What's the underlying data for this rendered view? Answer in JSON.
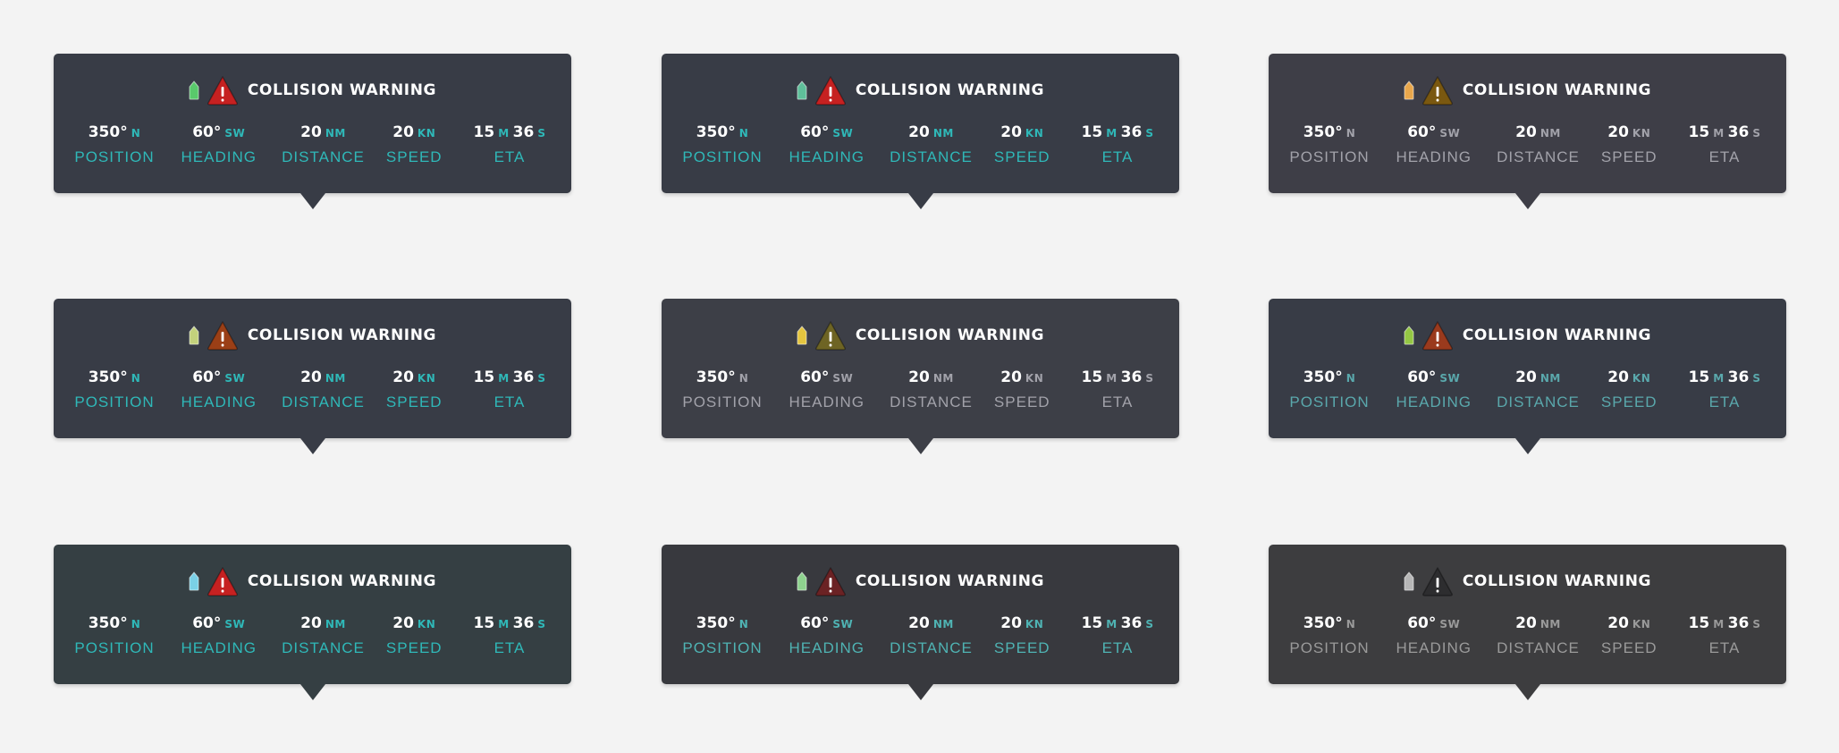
{
  "title": "COLLISION WARNING",
  "metrics": {
    "position": {
      "value": "350°",
      "unit": "N",
      "label": "POSITION"
    },
    "heading": {
      "value": "60°",
      "unit": "SW",
      "label": "HEADING"
    },
    "distance": {
      "value": "20",
      "unit": "NM",
      "label": "DISTANCE"
    },
    "speed": {
      "value": "20",
      "unit": "KN",
      "label": "SPEED"
    },
    "eta": {
      "minutes": "15",
      "minutes_unit": "M",
      "seconds": "36",
      "seconds_unit": "S",
      "label": "ETA"
    }
  },
  "cards": [
    {
      "bg": "#383c46",
      "accent": "#2fb8b8",
      "boat": "#59c96b",
      "warn": "#c62121"
    },
    {
      "bg": "#383c46",
      "accent": "#2fb8b8",
      "boat": "#5fbf9a",
      "warn": "#c62121"
    },
    {
      "bg": "#3e3e47",
      "accent": "#a2a2aa",
      "boat": "#e9a74c",
      "warn": "#7a5810"
    },
    {
      "bg": "#383c46",
      "accent": "#2fb8b8",
      "boat": "#c3d27c",
      "warn": "#9b3f16"
    },
    {
      "bg": "#3d3f47",
      "accent": "#a2a2aa",
      "boat": "#e4c53f",
      "warn": "#6e6424"
    },
    {
      "bg": "#383c46",
      "accent": "#5aa8ac",
      "boat": "#94c744",
      "warn": "#9a3a1d"
    },
    {
      "bg": "#353f43",
      "accent": "#2fb8b8",
      "boat": "#7ad0e6",
      "warn": "#c62121"
    },
    {
      "bg": "#38393e",
      "accent": "#4fb3b3",
      "boat": "#8ed28e",
      "warn": "#6b2224"
    },
    {
      "bg": "#3d3d3f",
      "accent": "#9a9a9a",
      "boat": "#b7b7b7",
      "warn": "#2d2d2f"
    }
  ]
}
